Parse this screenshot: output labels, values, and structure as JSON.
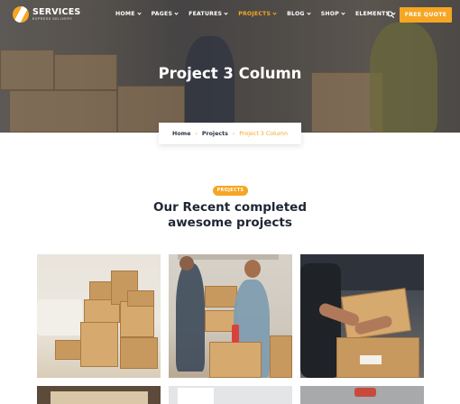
{
  "brand": {
    "name": "SERVICES",
    "tagline": "EXPRESS DELIVERY"
  },
  "nav": {
    "items": [
      {
        "label": "HOME",
        "active": false
      },
      {
        "label": "PAGES",
        "active": false
      },
      {
        "label": "FEATURES",
        "active": false
      },
      {
        "label": "PROJECTS",
        "active": true
      },
      {
        "label": "BLOG",
        "active": false
      },
      {
        "label": "SHOP",
        "active": false
      },
      {
        "label": "ELEMENTS",
        "active": false
      }
    ],
    "search_icon": "search-icon",
    "cta_label": "FREE QUOTE"
  },
  "hero": {
    "title": "Project 3 Column"
  },
  "breadcrumb": {
    "home": "Home",
    "section": "Projects",
    "current": "Project 3 Column"
  },
  "section": {
    "badge": "PROJECTS",
    "heading_line1": "Our Recent completed",
    "heading_line2": "awesome projects"
  },
  "colors": {
    "accent": "#f5a623",
    "dark": "#1e2635",
    "overlay": "#1b212c"
  }
}
